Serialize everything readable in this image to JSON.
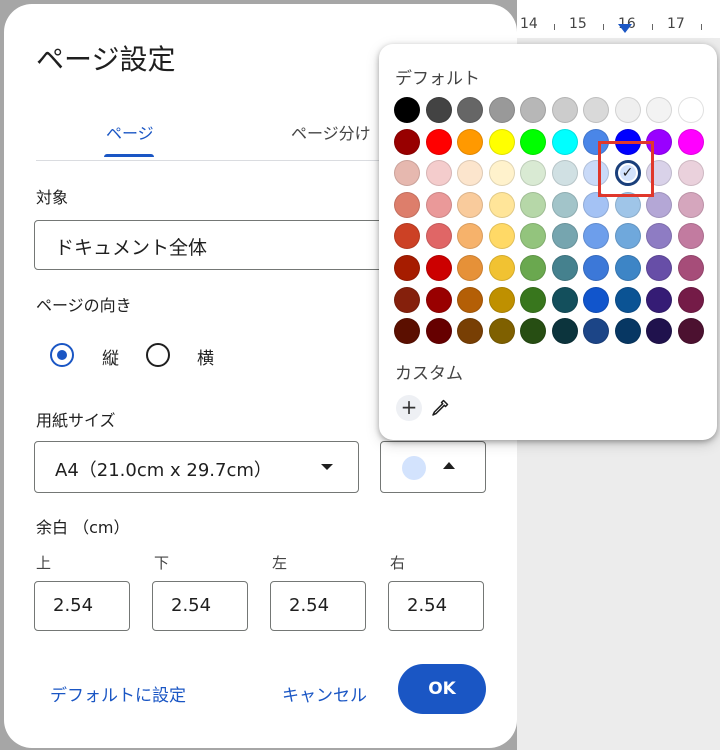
{
  "ruler": {
    "labels": [
      "14",
      "15",
      "16",
      "17"
    ]
  },
  "dialog": {
    "title": "ページ設定",
    "tabs": [
      {
        "label": "ページ",
        "active": true
      },
      {
        "label": "ページ分け",
        "active": false
      }
    ],
    "target": {
      "label": "対象",
      "value": "ドキュメント全体"
    },
    "orientation": {
      "label": "ページの向き",
      "options": [
        {
          "label": "縦",
          "selected": true
        },
        {
          "label": "横",
          "selected": false
        }
      ]
    },
    "paper_size": {
      "label": "用紙サイズ",
      "value": "A4（21.0cm x 29.7cm）"
    },
    "page_color": {
      "value": "#d3e3fd"
    },
    "margins": {
      "label": "余白 （cm）",
      "fields": [
        {
          "label": "上",
          "value": "2.54"
        },
        {
          "label": "下",
          "value": "2.54"
        },
        {
          "label": "左",
          "value": "2.54"
        },
        {
          "label": "右",
          "value": "2.54"
        }
      ]
    },
    "buttons": {
      "set_default": "デフォルトに設定",
      "cancel": "キャンセル",
      "ok": "OK"
    }
  },
  "palette": {
    "default_label": "デフォルト",
    "custom_label": "カスタム",
    "check_glyph": "✓",
    "add_glyph": "+",
    "rows": [
      [
        "#000000",
        "#434343",
        "#666666",
        "#999999",
        "#b7b7b7",
        "#cccccc",
        "#d9d9d9",
        "#efefef",
        "#f3f3f3",
        "#ffffff"
      ],
      [
        "#980000",
        "#ff0000",
        "#ff9900",
        "#ffff00",
        "#00ff00",
        "#00ffff",
        "#4a86e8",
        "#0000ff",
        "#9900ff",
        "#ff00ff"
      ],
      [
        "#e6b8af",
        "#f4cccc",
        "#fce5cd",
        "#fff2cc",
        "#d9ead3",
        "#d0e0e3",
        "#c9daf8",
        "#d3e3fd",
        "#d9d2e9",
        "#ead1dc"
      ],
      [
        "#dd7e6b",
        "#ea9999",
        "#f9cb9c",
        "#ffe599",
        "#b6d7a8",
        "#a2c4c9",
        "#a4c2f4",
        "#9fc5e8",
        "#b4a7d6",
        "#d5a6bd"
      ],
      [
        "#cc4125",
        "#e06666",
        "#f6b26b",
        "#ffd966",
        "#93c47d",
        "#76a5af",
        "#6d9eeb",
        "#6fa8dc",
        "#8e7cc3",
        "#c27ba0"
      ],
      [
        "#a61c00",
        "#cc0000",
        "#e69138",
        "#f1c232",
        "#6aa84f",
        "#45818e",
        "#3c78d8",
        "#3d85c6",
        "#674ea7",
        "#a64d79"
      ],
      [
        "#85200c",
        "#990000",
        "#b45f06",
        "#bf9000",
        "#38761d",
        "#134f5c",
        "#1155cc",
        "#0b5394",
        "#351c75",
        "#741b47"
      ],
      [
        "#5b0f00",
        "#660000",
        "#783f04",
        "#7f6000",
        "#274e13",
        "#0c343d",
        "#1c4587",
        "#073763",
        "#20124d",
        "#4c1130"
      ]
    ],
    "selected": {
      "row": 2,
      "col": 7
    }
  }
}
